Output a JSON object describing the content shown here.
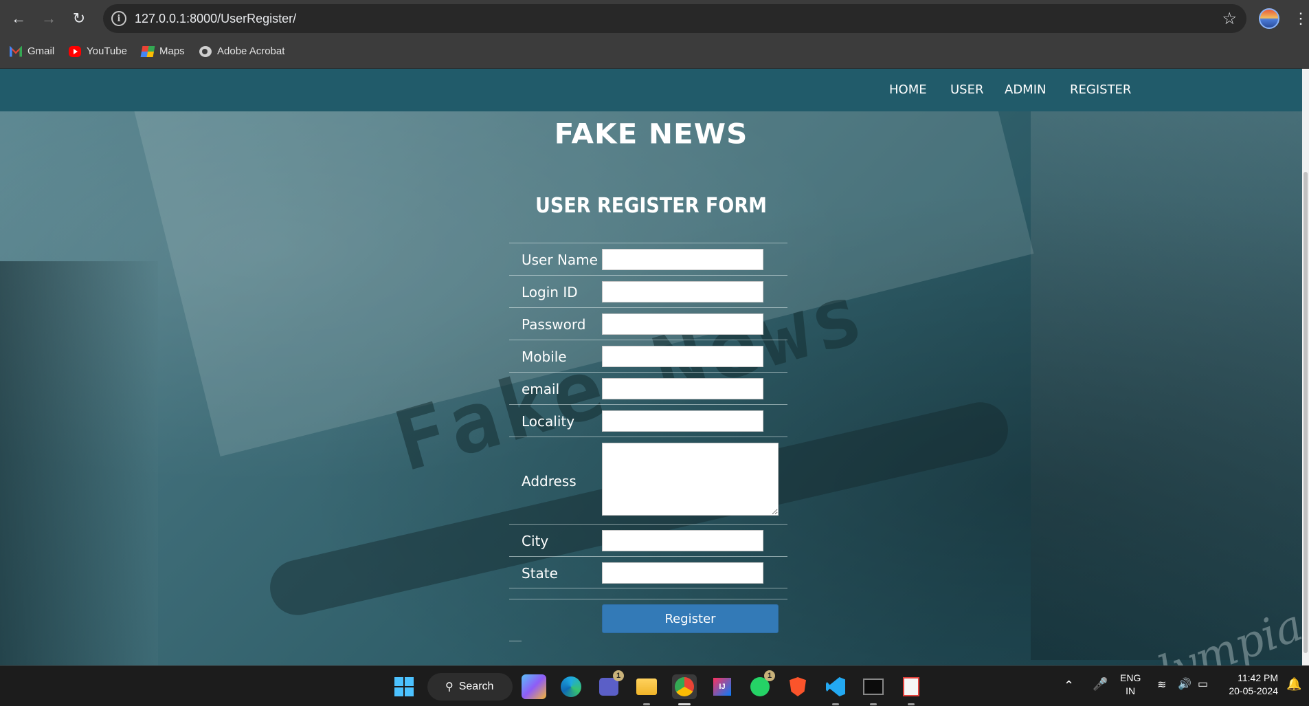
{
  "browser": {
    "url": "127.0.0.1:8000/UserRegister/",
    "bookmarks": [
      {
        "label": "Gmail",
        "icon": "gmail-icon"
      },
      {
        "label": "YouTube",
        "icon": "youtube-icon"
      },
      {
        "label": "Maps",
        "icon": "maps-icon"
      },
      {
        "label": "Adobe Acrobat",
        "icon": "globe-icon"
      }
    ]
  },
  "nav": {
    "items": [
      "HOME",
      "USER",
      "ADMIN",
      "REGISTER"
    ]
  },
  "site_title": "FAKE NEWS",
  "background_text": "Fake News",
  "background_brand": "olympia",
  "form": {
    "title": "USER REGISTER FORM",
    "fields": [
      {
        "label": "User Name",
        "value": ""
      },
      {
        "label": "Login ID",
        "value": ""
      },
      {
        "label": "Password",
        "value": ""
      },
      {
        "label": "Mobile",
        "value": ""
      },
      {
        "label": "email",
        "value": ""
      },
      {
        "label": "Locality",
        "value": ""
      },
      {
        "label": "Address",
        "value": ""
      },
      {
        "label": "City",
        "value": ""
      },
      {
        "label": "State",
        "value": ""
      }
    ],
    "submit_label": "Register"
  },
  "taskbar": {
    "search_label": "Search",
    "teams_badge": "1",
    "whatsapp_badge": "1",
    "language": "ENG",
    "region": "IN",
    "time": "11:42 PM",
    "date": "20-05-2024"
  },
  "colors": {
    "nav_bg": "#215b6a",
    "button": "#337ab7",
    "accent_windows": "#4cc2ff"
  }
}
